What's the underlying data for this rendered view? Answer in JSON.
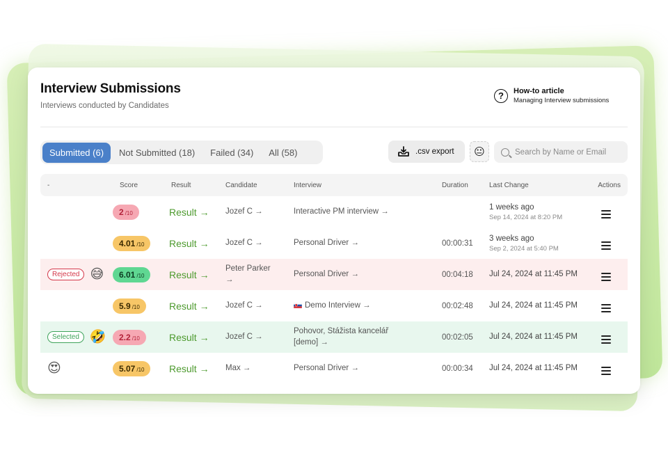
{
  "header": {
    "title": "Interview Submissions",
    "subtitle": "Interviews conducted by Candidates"
  },
  "howto": {
    "icon": "question-circle-icon",
    "title": "How-to article",
    "subtitle": "Managing Interview submissions"
  },
  "tabs": [
    {
      "label": "Submitted (6)",
      "active": true
    },
    {
      "label": "Not Submitted (18)",
      "active": false
    },
    {
      "label": "Failed (34)",
      "active": false
    },
    {
      "label": "All (58)",
      "active": false
    }
  ],
  "toolbar": {
    "csv_label": ".csv export",
    "search_placeholder": "Search by Name or Email"
  },
  "table": {
    "columns": [
      "-",
      "Score",
      "Result",
      "Candidate",
      "Interview",
      "Duration",
      "Last Change",
      "Actions"
    ],
    "rows": [
      {
        "status": "",
        "emoji": "",
        "score": "2",
        "score_denom": "/10",
        "score_color": "red",
        "result": "Result →",
        "candidate": "Jozef C →",
        "interview": "Interactive PM interview →",
        "duration": "",
        "last_main": "1 weeks ago",
        "last_sub": "Sep 14, 2024 at 8:20 PM"
      },
      {
        "status": "",
        "emoji": "",
        "score": "4.01",
        "score_denom": "/10",
        "score_color": "orange",
        "result": "Result →",
        "candidate": "Jozef C →",
        "interview": "Personal Driver →",
        "duration": "00:00:31",
        "last_main": "3 weeks ago",
        "last_sub": "Sep 2, 2024 at 5:40 PM"
      },
      {
        "status": "Rejected",
        "emoji": "😅",
        "score": "6.01",
        "score_denom": "/10",
        "score_color": "green",
        "result": "Result →",
        "candidate": "Peter Parker →",
        "interview": "Personal Driver →",
        "duration": "00:04:18",
        "last_main": "Jul 24, 2024 at 11:45 PM",
        "last_sub": ""
      },
      {
        "status": "",
        "emoji": "",
        "score": "5.9",
        "score_denom": "/10",
        "score_color": "orange",
        "result": "Result →",
        "candidate": "Jozef C →",
        "interview": "Demo Interview →",
        "interview_flag": "slovakia-flag-icon",
        "duration": "00:02:48",
        "last_main": "Jul 24, 2024 at 11:45 PM",
        "last_sub": ""
      },
      {
        "status": "Selected",
        "emoji": "🤣",
        "score": "2.2",
        "score_denom": "/10",
        "score_color": "red",
        "result": "Result →",
        "candidate": "Jozef C →",
        "interview": "Pohovor, Stážista kancelář [demo] →",
        "duration": "00:02:05",
        "last_main": "Jul 24, 2024 at 11:45 PM",
        "last_sub": ""
      },
      {
        "status": "",
        "emoji": "😍",
        "score": "5.07",
        "score_denom": "/10",
        "score_color": "orange",
        "result": "Result →",
        "candidate": "Max →",
        "interview": "Personal Driver →",
        "duration": "00:00:34",
        "last_main": "Jul 24, 2024 at 11:45 PM",
        "last_sub": ""
      }
    ]
  },
  "colors": {
    "accent": "#4a80c9",
    "result_green": "#4d9a2e",
    "rejected_row": "#fdeeee",
    "selected_row": "#e8f7ee"
  }
}
